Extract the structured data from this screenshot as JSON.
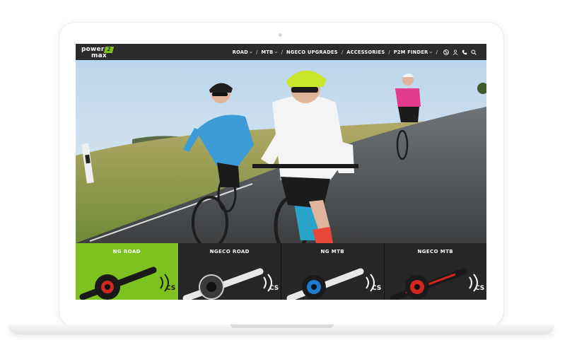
{
  "nav": {
    "logo": "power",
    "logo_badge": "2",
    "logo_sub": "max",
    "items": [
      {
        "label": "ROAD",
        "dropdown": true
      },
      {
        "label": "MTB",
        "dropdown": true
      },
      {
        "label": "NGECO UPGRADES",
        "dropdown": false
      },
      {
        "label": "ACCESSORIES",
        "dropdown": false
      },
      {
        "label": "P2M FINDER",
        "dropdown": true
      }
    ],
    "icons": [
      "globe-icon",
      "user-icon",
      "phone-icon",
      "search-icon"
    ]
  },
  "categories": [
    {
      "label": "NG ROAD",
      "spider": "#d0281e"
    },
    {
      "label": "NGECO ROAD",
      "spider": "#2b2b2b"
    },
    {
      "label": "NG MTB",
      "spider": "#1e7bd0"
    },
    {
      "label": "NGECO MTB",
      "spider": "#d0281e"
    }
  ],
  "colors": {
    "accent": "#7dc21e",
    "nav_bg": "#2b2b2b",
    "tile_bg": "#262626"
  }
}
